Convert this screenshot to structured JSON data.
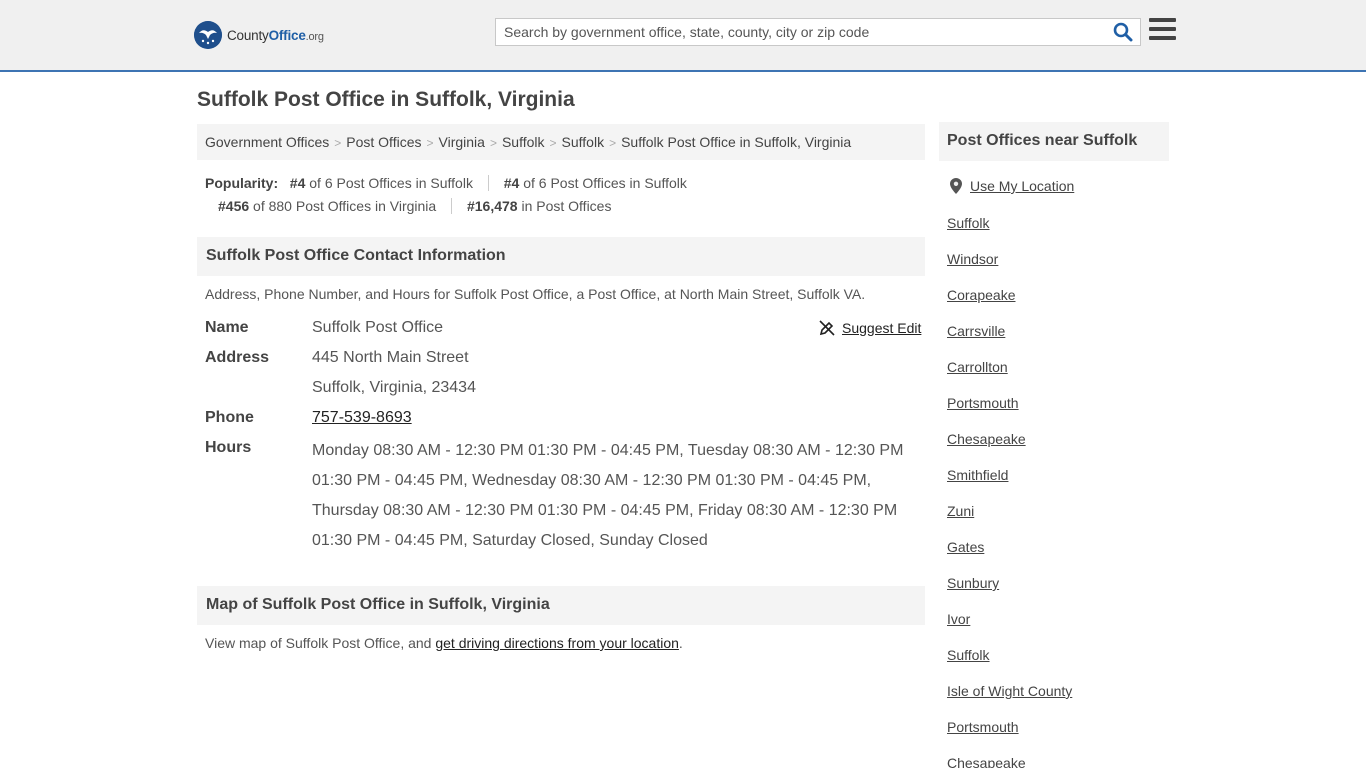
{
  "header": {
    "logo_county": "County",
    "logo_office": "Office",
    "logo_org": ".org",
    "search_placeholder": "Search by government office, state, county, city or zip code"
  },
  "page_title": "Suffolk Post Office in Suffolk, Virginia",
  "breadcrumb": [
    "Government Offices",
    "Post Offices",
    "Virginia",
    "Suffolk",
    "Suffolk",
    "Suffolk Post Office in Suffolk, Virginia"
  ],
  "popularity": {
    "label": "Popularity:",
    "items": [
      {
        "rank": "#4",
        "text": " of 6 Post Offices in Suffolk"
      },
      {
        "rank": "#4",
        "text": " of 6 Post Offices in Suffolk"
      },
      {
        "rank": "#456",
        "text": " of 880 Post Offices in Virginia"
      },
      {
        "rank": "#16,478",
        "text": " in Post Offices"
      }
    ]
  },
  "contact": {
    "heading": "Suffolk Post Office Contact Information",
    "description": "Address, Phone Number, and Hours for Suffolk Post Office, a Post Office, at North Main Street, Suffolk VA.",
    "suggest_edit": "Suggest Edit",
    "name_label": "Name",
    "name_value": "Suffolk Post Office",
    "address_label": "Address",
    "address_line1": "445 North Main Street",
    "address_line2": "Suffolk, Virginia, 23434",
    "phone_label": "Phone",
    "phone_value": "757-539-8693",
    "hours_label": "Hours",
    "hours_value": "Monday 08:30 AM - 12:30 PM 01:30 PM - 04:45 PM, Tuesday 08:30 AM - 12:30 PM 01:30 PM - 04:45 PM, Wednesday 08:30 AM - 12:30 PM 01:30 PM - 04:45 PM, Thursday 08:30 AM - 12:30 PM 01:30 PM - 04:45 PM, Friday 08:30 AM - 12:30 PM 01:30 PM - 04:45 PM, Saturday Closed, Sunday Closed"
  },
  "map": {
    "heading": "Map of Suffolk Post Office in Suffolk, Virginia",
    "text_before": "View map of Suffolk Post Office, and ",
    "link": "get driving directions from your location",
    "text_after": "."
  },
  "sidebar": {
    "heading": "Post Offices near Suffolk",
    "use_location": "Use My Location",
    "items": [
      "Suffolk",
      "Windsor",
      "Corapeake",
      "Carrsville",
      "Carrollton",
      "Portsmouth",
      "Chesapeake",
      "Smithfield",
      "Zuni",
      "Gates",
      "Sunbury",
      "Ivor",
      "Suffolk",
      "Isle of Wight County",
      "Portsmouth",
      "Chesapeake"
    ]
  },
  "colors": {
    "accent_blue": "#1f5fa6",
    "header_border": "#3d74b3",
    "panel_gray": "#f4f4f4"
  },
  "icons": [
    "seal-logo-icon",
    "search-icon",
    "hamburger-menu-icon",
    "suggest-edit-icon",
    "location-pin-icon"
  ]
}
